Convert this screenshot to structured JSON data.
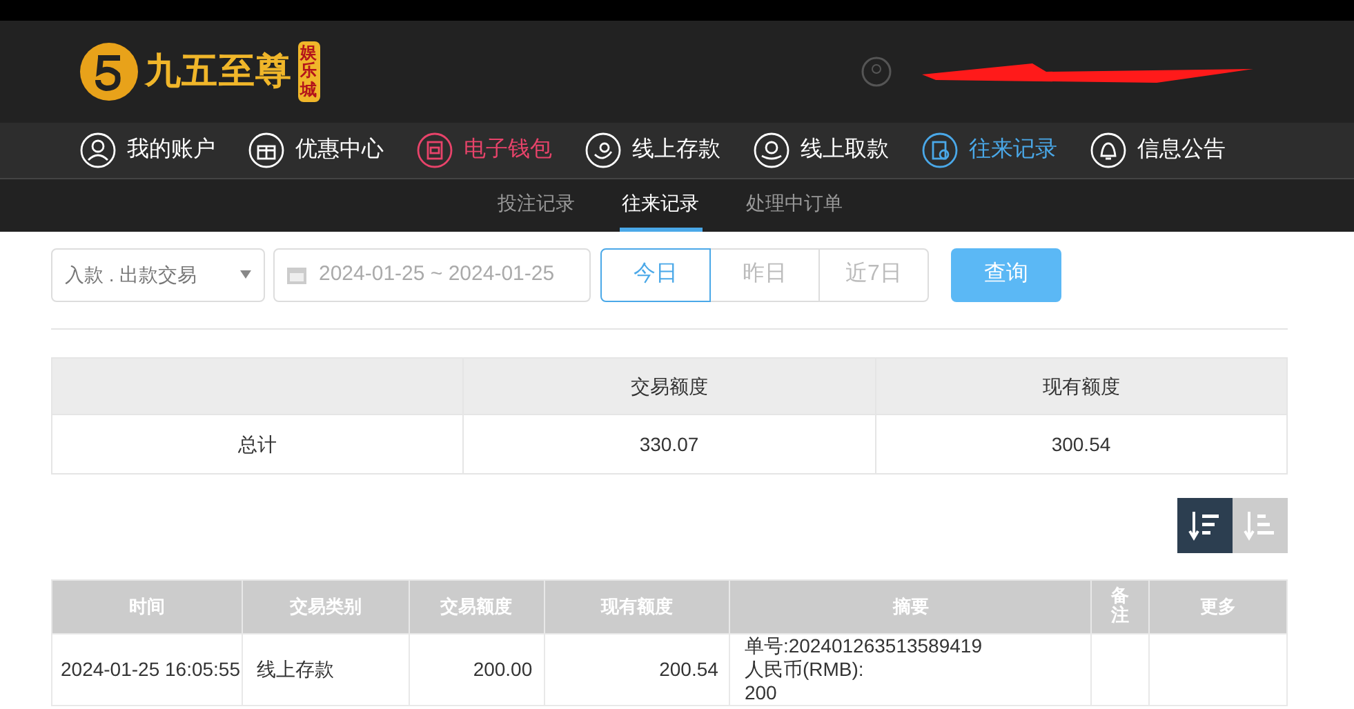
{
  "logo": {
    "title": "九五至尊",
    "badge": "娱乐城"
  },
  "nav": [
    {
      "label": "我的账户",
      "kind": "user",
      "selected": false
    },
    {
      "label": "优惠中心",
      "kind": "gift",
      "selected": false
    },
    {
      "label": "电子钱包",
      "kind": "wallet",
      "selected": false,
      "highlight": true
    },
    {
      "label": "线上存款",
      "kind": "deposit",
      "selected": false
    },
    {
      "label": "线上取款",
      "kind": "withdraw",
      "selected": false
    },
    {
      "label": "往来记录",
      "kind": "record",
      "selected": true
    },
    {
      "label": "信息公告",
      "kind": "bell",
      "selected": false
    }
  ],
  "subnav": [
    {
      "label": "投注记录",
      "selected": false
    },
    {
      "label": "往来记录",
      "selected": true
    },
    {
      "label": "处理中订单",
      "selected": false
    }
  ],
  "filter": {
    "type": "入款 . 出款交易",
    "date_range": "2024-01-25 ~ 2024-01-25",
    "ranges": [
      {
        "label": "今日",
        "selected": true
      },
      {
        "label": "昨日",
        "selected": false
      },
      {
        "label": "近7日",
        "selected": false
      }
    ],
    "query": "查询"
  },
  "summary": {
    "columns": [
      "交易额度",
      "现有额度"
    ],
    "row": {
      "label": "总计",
      "values": [
        "330.07",
        "300.54"
      ]
    }
  },
  "sort": [
    {
      "kind": "desc",
      "selected": true
    },
    {
      "kind": "asc",
      "selected": false
    }
  ],
  "table": {
    "columns": [
      "时间",
      "交易类别",
      "交易额度",
      "现有额度",
      "摘要",
      "备注",
      "更多"
    ],
    "rows": [
      {
        "time": "2024-01-25 16:05:55",
        "type": "线上存款",
        "amount": "200.00",
        "balance": "200.54",
        "summary": [
          "单号:202401263513589419",
          "人民币(RMB):",
          "200"
        ]
      }
    ]
  }
}
